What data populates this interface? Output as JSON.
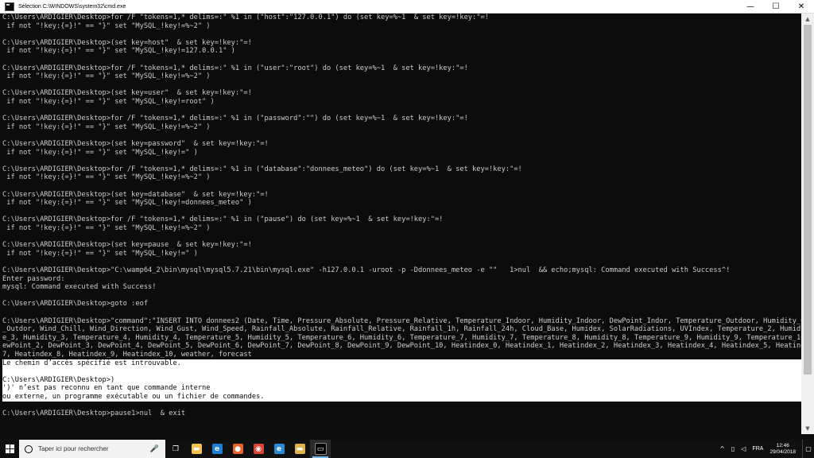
{
  "window": {
    "title": "Sélection C:\\WINDOWS\\system32\\cmd.exe",
    "icon": "cmd-icon",
    "minimize": "—",
    "maximize": "☐",
    "close": "✕"
  },
  "console": {
    "lines": [
      {
        "text": "C:\\Users\\ARDIGIER\\Desktop>for /F \"tokens=1,* delims=:\" %1 in (\"host\":\"127.0.0.1\") do (set key=%~1  & set key=!key:\"=!",
        "selected": false
      },
      {
        "text": " if not \"!key:{=}!\" == \"}\" set \"MySQL_!key!=%~2\" )",
        "selected": false
      },
      {
        "text": "",
        "selected": false
      },
      {
        "text": "C:\\Users\\ARDIGIER\\Desktop>(set key=host\"  & set key=!key:\"=!",
        "selected": false
      },
      {
        "text": " if not \"!key:{=}!\" == \"}\" set \"MySQL_!key!=127.0.0.1\" )",
        "selected": false
      },
      {
        "text": "",
        "selected": false
      },
      {
        "text": "C:\\Users\\ARDIGIER\\Desktop>for /F \"tokens=1,* delims=:\" %1 in (\"user\":\"root\") do (set key=%~1  & set key=!key:\"=!",
        "selected": false
      },
      {
        "text": " if not \"!key:{=}!\" == \"}\" set \"MySQL_!key!=%~2\" )",
        "selected": false
      },
      {
        "text": "",
        "selected": false
      },
      {
        "text": "C:\\Users\\ARDIGIER\\Desktop>(set key=user\"  & set key=!key:\"=!",
        "selected": false
      },
      {
        "text": " if not \"!key:{=}!\" == \"}\" set \"MySQL_!key!=root\" )",
        "selected": false
      },
      {
        "text": "",
        "selected": false
      },
      {
        "text": "C:\\Users\\ARDIGIER\\Desktop>for /F \"tokens=1,* delims=:\" %1 in (\"password\":\"\") do (set key=%~1  & set key=!key:\"=!",
        "selected": false
      },
      {
        "text": " if not \"!key:{=}!\" == \"}\" set \"MySQL_!key!=%~2\" )",
        "selected": false
      },
      {
        "text": "",
        "selected": false
      },
      {
        "text": "C:\\Users\\ARDIGIER\\Desktop>(set key=password\"  & set key=!key:\"=!",
        "selected": false
      },
      {
        "text": " if not \"!key:{=}!\" == \"}\" set \"MySQL_!key!=\" )",
        "selected": false
      },
      {
        "text": "",
        "selected": false
      },
      {
        "text": "C:\\Users\\ARDIGIER\\Desktop>for /F \"tokens=1,* delims=:\" %1 in (\"database\":\"donnees_meteo\") do (set key=%~1  & set key=!key:\"=!",
        "selected": false
      },
      {
        "text": " if not \"!key:{=}!\" == \"}\" set \"MySQL_!key!=%~2\" )",
        "selected": false
      },
      {
        "text": "",
        "selected": false
      },
      {
        "text": "C:\\Users\\ARDIGIER\\Desktop>(set key=database\"  & set key=!key:\"=!",
        "selected": false
      },
      {
        "text": " if not \"!key:{=}!\" == \"}\" set \"MySQL_!key!=donnees_meteo\" )",
        "selected": false
      },
      {
        "text": "",
        "selected": false
      },
      {
        "text": "C:\\Users\\ARDIGIER\\Desktop>for /F \"tokens=1,* delims=:\" %1 in (\"pause\") do (set key=%~1  & set key=!key:\"=!",
        "selected": false
      },
      {
        "text": " if not \"!key:{=}!\" == \"}\" set \"MySQL_!key!=%~2\" )",
        "selected": false
      },
      {
        "text": "",
        "selected": false
      },
      {
        "text": "C:\\Users\\ARDIGIER\\Desktop>(set key=pause  & set key=!key:\"=!",
        "selected": false
      },
      {
        "text": " if not \"!key:{=}!\" == \"}\" set \"MySQL_!key!=\" )",
        "selected": false
      },
      {
        "text": "",
        "selected": false
      },
      {
        "text": "C:\\Users\\ARDIGIER\\Desktop>\"C:\\wamp64_2\\bin\\mysql\\mysql5.7.21\\bin\\mysql.exe\" -h127.0.0.1 -uroot -p -Ddonnees_meteo -e \"\"   1>nul  && echo;mysql: Command executed with Success^!",
        "selected": false
      },
      {
        "text": "Enter password:",
        "selected": false
      },
      {
        "text": "mysql: Command executed with Success!",
        "selected": false
      },
      {
        "text": "",
        "selected": false
      },
      {
        "text": "C:\\Users\\ARDIGIER\\Desktop>goto :eof",
        "selected": false
      },
      {
        "text": "",
        "selected": false
      },
      {
        "text": "C:\\Users\\ARDIGIER\\Desktop>\"command\":\"INSERT INTO donnees2 (Date, Time, Pressure_Absolute, Pressure_Relative, Temperature_Indoor, Humidity_Indoor, DewPoint_Indor, Temperature_Outdoor, Humidity_Outdoor, DewPoint",
        "selected": false
      },
      {
        "text": "_Outdor, Wind_Chill, Wind_Direction, Wind_Gust, Wind_Speed, Rainfall_Absolute, Rainfall_Relative, Rainfall_1h, Rainfall_24h, Cloud_Base, Humidex, SolarRadiations, UVIndex, Temperature_2, Humidity_2, Temperatur",
        "selected": false
      },
      {
        "text": "e_3, Humidity_3, Temperature_4, Humidity_4, Temperature_5, Humidity_5, Temperature_6, Humidity_6, Temperature_7, Humidity_7, Temperature_8, Humidity_8, Temperature_9, Humidity_9, Temperature_10, Humidity_10, D",
        "selected": false
      },
      {
        "text": "ewPoint_2, DewPoint_3, DewPoint_4, DewPoint_5, DewPoint_6, DewPoint_7, DewPoint_8, DewPoint_9, DewPoint_10, Heatindex_0, Heatindex_1, Heatindex_2, Heatindex_3, Heatindex_4, Heatindex_5, Heatindex_6, Heatindex_",
        "selected": false
      },
      {
        "text": "7, Heatindex_8, Heatindex_9, Heatindex_10, weather, forecast",
        "selected": false
      },
      {
        "text": "Le chemin d’accès spécifié est introuvable.",
        "selected": true
      },
      {
        "text": "",
        "selected": true
      },
      {
        "text": "C:\\Users\\ARDIGIER\\Desktop>)",
        "selected": true
      },
      {
        "text": "')' n’est pas reconnu en tant que commande interne",
        "selected": true
      },
      {
        "text": "ou externe, un programme exécutable ou un fichier de commandes.",
        "selected": true
      },
      {
        "text": "",
        "selected": false
      },
      {
        "text": "C:\\Users\\ARDIGIER\\Desktop>pause1>nul  & exit",
        "selected": false
      }
    ]
  },
  "scrollbar": {
    "up_arrow": "▲",
    "down_arrow": "▼"
  },
  "taskbar": {
    "search_placeholder": "Taper ici pour rechercher",
    "mic": "🎤",
    "pinned": [
      {
        "name": "task-view-icon",
        "glyph": "❐",
        "color": "transparent",
        "active": false
      },
      {
        "name": "file-explorer-icon",
        "glyph": "▬",
        "color": "#f2c14e",
        "active": false
      },
      {
        "name": "edge-icon",
        "glyph": "e",
        "color": "#1e7fd6",
        "active": false
      },
      {
        "name": "firefox-icon",
        "glyph": "●",
        "color": "#e8632a",
        "active": false
      },
      {
        "name": "chrome-icon",
        "glyph": "◉",
        "color": "#db4437",
        "active": false
      },
      {
        "name": "internet-explorer-icon",
        "glyph": "e",
        "color": "#2a8ad4",
        "active": false
      },
      {
        "name": "folder-icon",
        "glyph": "▬",
        "color": "#e0b34c",
        "active": false
      },
      {
        "name": "cmd-icon",
        "glyph": "▭",
        "color": "#000000",
        "active": true
      }
    ],
    "tray": {
      "chevron": "^",
      "network": "▯",
      "volume": "◁",
      "language": "FRA",
      "time": "12:46",
      "date": "29/04/2018",
      "notification": "▢"
    }
  }
}
